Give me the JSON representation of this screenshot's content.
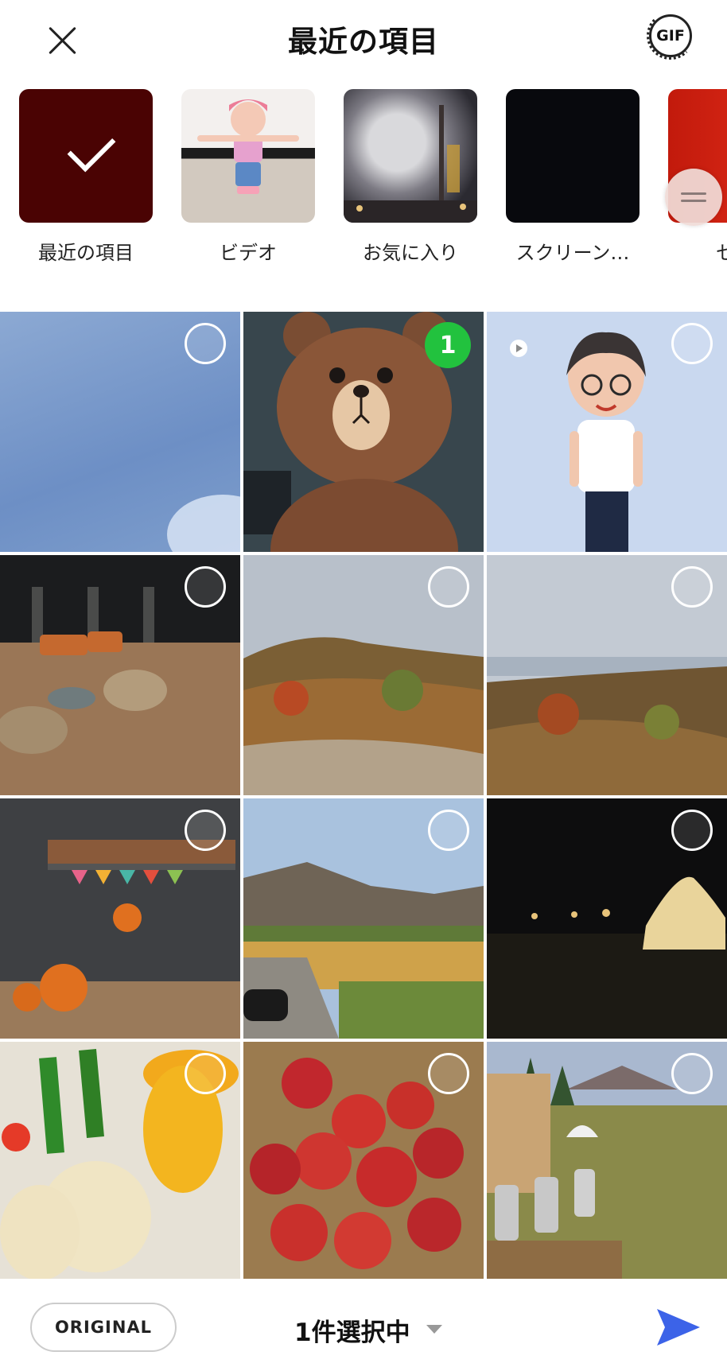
{
  "header": {
    "title": "最近の項目",
    "gif_label": "GIF"
  },
  "albums": [
    {
      "label": "最近の項目",
      "selected": true
    },
    {
      "label": "ビデオ"
    },
    {
      "label": "お気に入り"
    },
    {
      "label": "スクリーン…"
    },
    {
      "label": "セル"
    }
  ],
  "photos": [
    {
      "name": "sky",
      "selected": false
    },
    {
      "name": "brown-bear",
      "selected": true,
      "order": "1"
    },
    {
      "name": "avatar",
      "selected": false
    },
    {
      "name": "lounge",
      "selected": false
    },
    {
      "name": "autumn-hills",
      "selected": false
    },
    {
      "name": "autumn-valley",
      "selected": false
    },
    {
      "name": "bookshelf-pumpkins",
      "selected": false
    },
    {
      "name": "field-road",
      "selected": false
    },
    {
      "name": "night-tents",
      "selected": false
    },
    {
      "name": "vegetables",
      "selected": false
    },
    {
      "name": "apples",
      "selected": false
    },
    {
      "name": "camp-field",
      "selected": false
    }
  ],
  "bottom": {
    "original_label": "ORIGINAL",
    "selection_text": "1件選択中"
  },
  "colors": {
    "accent": "#3c63e8",
    "selected_badge": "#22c23e"
  }
}
